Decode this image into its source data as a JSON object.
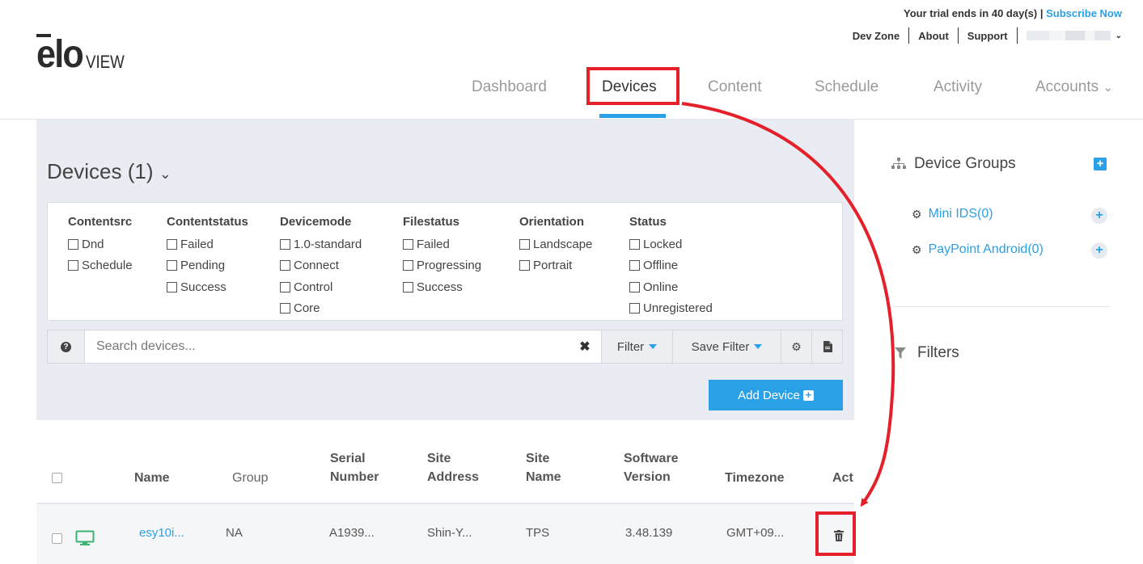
{
  "header": {
    "trial_text": "Your trial ends in 40 day(s) | ",
    "subscribe_label": "Subscribe Now",
    "links": [
      "Dev Zone",
      "About",
      "Support"
    ],
    "logo_main": "elo",
    "logo_sub": "VIEW"
  },
  "nav": {
    "dashboard": "Dashboard",
    "devices": "Devices",
    "content": "Content",
    "schedule": "Schedule",
    "activity": "Activity",
    "accounts": "Accounts"
  },
  "devices_panel": {
    "title": "Devices (1)",
    "filters": [
      {
        "heading": "Contentsrc",
        "options": [
          "Dnd",
          "Schedule"
        ]
      },
      {
        "heading": "Contentstatus",
        "options": [
          "Failed",
          "Pending",
          "Success"
        ]
      },
      {
        "heading": "Devicemode",
        "options": [
          "1.0-standard",
          "Connect",
          "Control",
          "Core"
        ]
      },
      {
        "heading": "Filestatus",
        "options": [
          "Failed",
          "Progressing",
          "Success"
        ]
      },
      {
        "heading": "Orientation",
        "options": [
          "Landscape",
          "Portrait"
        ]
      },
      {
        "heading": "Status",
        "options": [
          "Locked",
          "Offline",
          "Online",
          "Unregistered"
        ]
      }
    ],
    "search_placeholder": "Search devices...",
    "filter_label": "Filter",
    "save_filter_label": "Save Filter",
    "add_device_label": "Add Device"
  },
  "table": {
    "headers": {
      "name": "Name",
      "group": "Group",
      "serial_1": "Serial",
      "serial_2": "Number",
      "site_address_1": "Site",
      "site_address_2": "Address",
      "site_name_1": "Site",
      "site_name_2": "Name",
      "software_1": "Software",
      "software_2": "Version",
      "timezone": "Timezone",
      "actions": "Act"
    },
    "row": {
      "name": "esy10i...",
      "group": "NA",
      "serial": "A1939...",
      "site_address": "Shin-Y...",
      "site_name": "TPS",
      "software_version": "3.48.139",
      "timezone": "GMT+09..."
    }
  },
  "sidebar": {
    "device_groups_title": "Device Groups",
    "groups": [
      "Mini IDS(0)",
      "PayPoint Android(0)"
    ],
    "filters_title": "Filters"
  },
  "colors": {
    "accent": "#2aa0e6",
    "annotation_red": "#e5202a",
    "panel_bg": "#e9ecf2",
    "device_online_green": "#3cb371"
  },
  "icons": [
    "help-icon",
    "clear-icon",
    "gear-icon",
    "document-icon",
    "plus-icon",
    "sitemap-icon",
    "funnel-icon",
    "monitor-icon",
    "trash-icon",
    "chevron-down-icon"
  ]
}
